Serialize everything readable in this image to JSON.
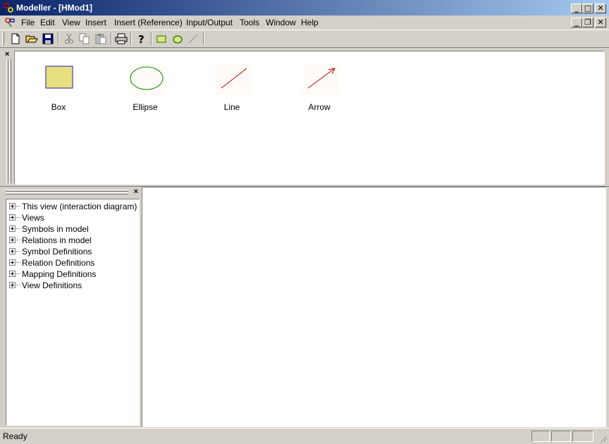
{
  "window": {
    "title": "Modeller - [HMod1]",
    "icon": "modeller-app-icon",
    "controls": {
      "minimize": "_",
      "maximize": "□",
      "close": "✕",
      "restore": "❐"
    }
  },
  "menu": {
    "items": [
      {
        "label": "File"
      },
      {
        "label": "Edit"
      },
      {
        "label": "View"
      },
      {
        "label": "Insert"
      },
      {
        "label": "Insert (Reference)"
      },
      {
        "label": "Input/Output"
      },
      {
        "label": "Tools"
      },
      {
        "label": "Window"
      },
      {
        "label": "Help"
      }
    ]
  },
  "toolbar": {
    "buttons": [
      "new-document-icon",
      "open-folder-icon",
      "save-icon",
      "cut-icon",
      "copy-icon",
      "paste-icon",
      "print-icon",
      "help-icon",
      "box-tool-icon",
      "ellipse-tool-icon",
      "line-tool-icon"
    ]
  },
  "palette": {
    "close": "×",
    "shapes": [
      {
        "label": "Box"
      },
      {
        "label": "Ellipse"
      },
      {
        "label": "Line"
      },
      {
        "label": "Arrow"
      }
    ]
  },
  "tree": {
    "close": "×",
    "items": [
      {
        "label": "This view (interaction diagram)"
      },
      {
        "label": "Views"
      },
      {
        "label": "Symbols in model"
      },
      {
        "label": "Relations in model"
      },
      {
        "label": "Symbol Definitions"
      },
      {
        "label": "Relation Definitions"
      },
      {
        "label": "Mapping Definitions"
      },
      {
        "label": "View Definitions"
      }
    ]
  },
  "status": {
    "text": "Ready"
  },
  "colors": {
    "title_start": "#0a246a",
    "title_end": "#a6caf0",
    "box_fill": "#e8e080",
    "box_stroke": "#2020a0",
    "ellipse_stroke": "#008000",
    "line_stroke": "#c00000"
  }
}
